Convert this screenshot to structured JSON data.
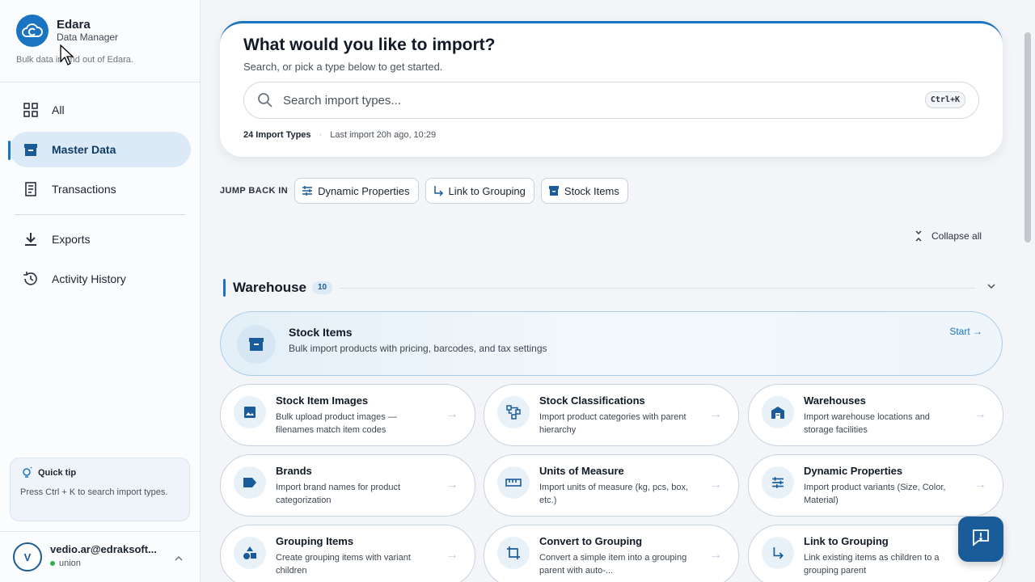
{
  "brand": {
    "name": "Edara",
    "subtitle": "Data Manager",
    "description": "Bulk data in and out of Edara."
  },
  "nav": {
    "items": [
      {
        "label": "All",
        "icon": "grid-icon"
      },
      {
        "label": "Master Data",
        "icon": "archive-box-icon",
        "active": true
      },
      {
        "label": "Transactions",
        "icon": "receipt-icon"
      },
      {
        "label": "Exports",
        "icon": "download-icon"
      },
      {
        "label": "Activity History",
        "icon": "history-icon"
      }
    ]
  },
  "tip": {
    "title": "Quick tip",
    "text": "Press Ctrl + K to search import types."
  },
  "user": {
    "initial": "V",
    "email": "vedio.ar@edraksoft...",
    "org": "union",
    "status_color": "#2bb052"
  },
  "hero": {
    "title": "What would you like to import?",
    "subtitle": "Search, or pick a type below to get started.",
    "search_placeholder": "Search import types...",
    "shortcut": "Ctrl+K",
    "count_label": "24 Import Types",
    "last_import": "Last import 20h ago, 10:29"
  },
  "jump": {
    "label": "JUMP BACK IN",
    "chips": [
      {
        "label": "Dynamic Properties",
        "icon": "sliders-icon"
      },
      {
        "label": "Link to Grouping",
        "icon": "link-arrow-icon"
      },
      {
        "label": "Stock Items",
        "icon": "archive-box-icon"
      }
    ]
  },
  "collapse_label": "Collapse all",
  "section": {
    "title": "Warehouse",
    "count": "10"
  },
  "featured": {
    "title": "Stock Items",
    "description": "Bulk import products with pricing, barcodes, and tax settings",
    "action": "Start →"
  },
  "cards": [
    {
      "title": "Stock Item Images",
      "description": "Bulk upload product images — filenames match item codes",
      "icon": "image-icon"
    },
    {
      "title": "Stock Classifications",
      "description": "Import product categories with parent hierarchy",
      "icon": "hierarchy-icon"
    },
    {
      "title": "Warehouses",
      "description": "Import warehouse locations and storage facilities",
      "icon": "warehouse-icon"
    },
    {
      "title": "Brands",
      "description": "Import brand names for product categorization",
      "icon": "tag-icon"
    },
    {
      "title": "Units of Measure",
      "description": "Import units of measure (kg, pcs, box, etc.)",
      "icon": "ruler-icon"
    },
    {
      "title": "Dynamic Properties",
      "description": "Import product variants (Size, Color, Material)",
      "icon": "sliders-icon"
    },
    {
      "title": "Grouping Items",
      "description": "Create grouping items with variant children",
      "icon": "shapes-icon"
    },
    {
      "title": "Convert to Grouping",
      "description": "Convert a simple item into a grouping parent with auto-...",
      "icon": "crop-icon"
    },
    {
      "title": "Link to Grouping",
      "description": "Link existing items as children to a grouping parent",
      "icon": "link-arrow-icon"
    }
  ],
  "colors": {
    "accent": "#1a74c2",
    "accent_dark": "#1a5c99",
    "active_bg": "#dbeaf6"
  }
}
